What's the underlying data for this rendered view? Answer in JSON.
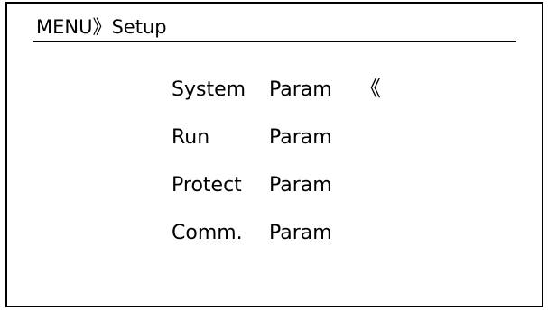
{
  "header": {
    "title": "MENU》Setup"
  },
  "menu": {
    "items": [
      {
        "name": "System",
        "suffix": "Param",
        "cursor": "《"
      },
      {
        "name": "Run",
        "suffix": "Param",
        "cursor": ""
      },
      {
        "name": "Protect",
        "suffix": "Param",
        "cursor": ""
      },
      {
        "name": "Comm.",
        "suffix": "Param",
        "cursor": ""
      }
    ],
    "selected_index": 0
  }
}
